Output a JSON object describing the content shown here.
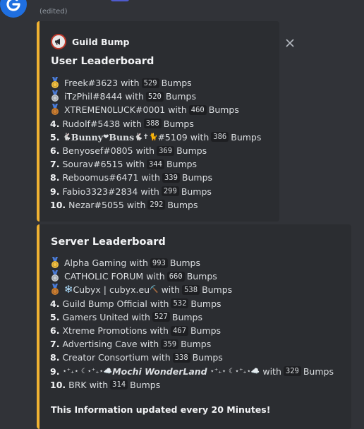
{
  "message": {
    "edited_label": "(edited)"
  },
  "user_embed": {
    "author": "Guild Bump",
    "title": "User Leaderboard",
    "rows": [
      {
        "rank": "",
        "medal": "gold",
        "name": "Freek#3623",
        "with": "with",
        "count": "529",
        "unit": "Bumps"
      },
      {
        "rank": "",
        "medal": "silver",
        "name": "iTzPhil#8444",
        "with": "with",
        "count": "520",
        "unit": "Bumps"
      },
      {
        "rank": "",
        "medal": "bronze",
        "name": "XTREMEN0LUCK#0001",
        "with": "with",
        "count": "460",
        "unit": "Bumps"
      },
      {
        "rank": "4.",
        "name": "Rudolf#5438",
        "with": "with",
        "count": "388",
        "unit": "Bumps"
      },
      {
        "rank": "5.",
        "name": "𝐁𝐮𝐧𝐧𝐲",
        "name2": "𝐁𝐮𝐧𝐬",
        "tag": "#5109",
        "with": "with",
        "count": "386",
        "unit": "Bumps"
      },
      {
        "rank": "6.",
        "name": "Benyosef#0805",
        "with": "with",
        "count": "369",
        "unit": "Bumps"
      },
      {
        "rank": "7.",
        "name": "Sourav#6515",
        "with": "with",
        "count": "344",
        "unit": "Bumps"
      },
      {
        "rank": "8.",
        "name": "Reboomus#6471",
        "with": "with",
        "count": "339",
        "unit": "Bumps"
      },
      {
        "rank": "9.",
        "name": "Fabio3323#2834",
        "with": "with",
        "count": "299",
        "unit": "Bumps"
      },
      {
        "rank": "10.",
        "name": "Nezar#5055",
        "with": "with",
        "count": "292",
        "unit": "Bumps"
      }
    ]
  },
  "server_embed": {
    "title": "Server Leaderboard",
    "rows": [
      {
        "rank": "",
        "medal": "gold",
        "name": "Alpha Gaming",
        "with": "with",
        "count": "993",
        "unit": "Bumps"
      },
      {
        "rank": "",
        "medal": "silver",
        "name": "CATHOLIC FORUM",
        "with": "with",
        "count": "660",
        "unit": "Bumps"
      },
      {
        "rank": "",
        "medal": "bronze",
        "name": "Cubyx | cubyx.eu",
        "with": "with",
        "count": "538",
        "unit": "Bumps"
      },
      {
        "rank": "4.",
        "name": "Guild Bump Official",
        "with": "with",
        "count": "532",
        "unit": "Bumps"
      },
      {
        "rank": "5.",
        "name": "Gamers United",
        "with": "with",
        "count": "527",
        "unit": "Bumps"
      },
      {
        "rank": "6.",
        "name": "Xtreme Promotions",
        "with": "with",
        "count": "467",
        "unit": "Bumps"
      },
      {
        "rank": "7.",
        "name": "Advertising Cave",
        "with": "with",
        "count": "359",
        "unit": "Bumps"
      },
      {
        "rank": "8.",
        "name": "Creator Consortium",
        "with": "with",
        "count": "338",
        "unit": "Bumps"
      },
      {
        "rank": "9.",
        "deco": "⋆⁺₊⋆ ☾⋆⁺₊⋆",
        "name": "Mochi WonderLand",
        "with": "with",
        "count": "329",
        "unit": "Bumps"
      },
      {
        "rank": "10.",
        "name": "BRK",
        "with": "with",
        "count": "314",
        "unit": "Bumps"
      }
    ],
    "footer": "This Information updated every 20 Minutes!"
  },
  "colors": {
    "accent": "#f0b232",
    "gold": "#f5c242",
    "silver": "#c7ccd1",
    "bronze": "#cd7f32",
    "ribbon": "#4a7bd6"
  }
}
